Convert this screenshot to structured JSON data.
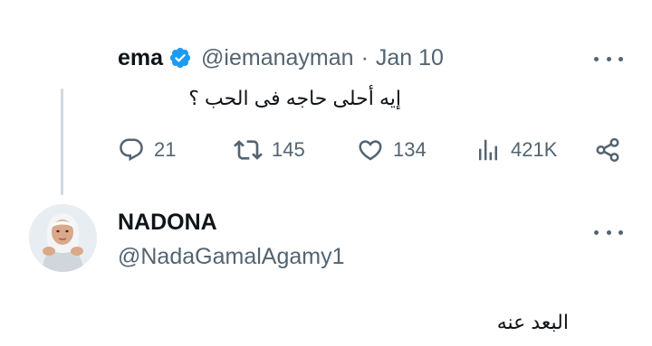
{
  "tweet": {
    "author_name": "ema",
    "handle": "@iemanayman",
    "separator": "·",
    "date": "Jan 10",
    "text": "إيه أحلى حاجه فى الحب ؟",
    "stats": {
      "replies": "21",
      "retweets": "145",
      "likes": "134",
      "views": "421K"
    }
  },
  "reply": {
    "author_name": "NADONA",
    "handle": "@NadaGamalAgamy1",
    "text": "البعد عنه"
  },
  "colors": {
    "text_primary": "#0f1419",
    "text_secondary": "#536471",
    "verified_blue": "#1d9bf0",
    "thread_line": "#cfd9de"
  },
  "icons": [
    "verified-badge-icon",
    "more-icon",
    "reply-icon",
    "retweet-icon",
    "like-icon",
    "views-icon",
    "share-icon"
  ]
}
